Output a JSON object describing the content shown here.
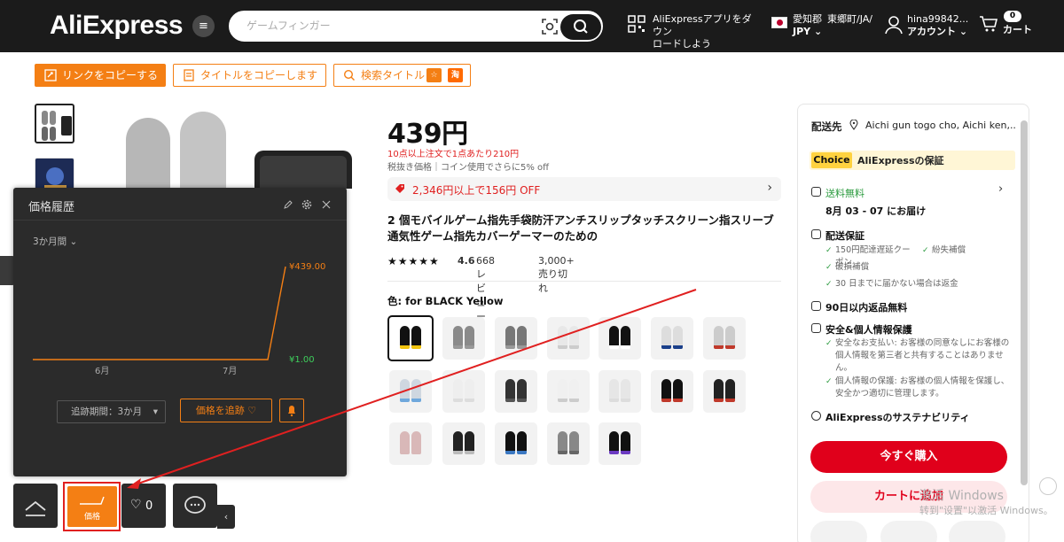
{
  "header": {
    "logo": "AliExpress",
    "search_placeholder": "ゲームフィンガー",
    "app_line1": "AliExpressアプリをダウン",
    "app_line2": "ロードしよう",
    "region": "愛知郡",
    "currency": "JPY",
    "address": "東郷町/JA/",
    "user": "hina99842...",
    "account": "アカウント",
    "cart_count": "0",
    "cart_label": "カート"
  },
  "toolbar": {
    "copy_link": "リンクをコピーする",
    "copy_title": "タイトルをコピーします",
    "search_title": "検索タイトル"
  },
  "product": {
    "price": "439円",
    "bulk_offer": "10点以上注文で1点あたり210円",
    "tax_note": "税抜き価格｜コイン使用でさらに5% off",
    "coupon": "2,346円以上で156円 OFF",
    "title": "2 個モバイルゲーム指先手袋防汗アンチスリップタッチスクリーン指スリーブ通気性ゲーム指先カバーゲーマーのための",
    "stars": "★★★★★",
    "rating": "4.6",
    "reviews": "668 レビュー",
    "sold": "3,000+ 売り切れ",
    "color_label": "色: for BLACK Yellow"
  },
  "right_panel": {
    "ship_label": "配送先",
    "ship_address": "Aichi gun togo cho, Aichi ken,...",
    "choice_badge": "Choice",
    "choice_text": "AliExpressの保証",
    "free_shipping": "送料無料",
    "delivery": "8月 03 - 07 にお届け",
    "guarantee_title": "配送保証",
    "guarantee_items": [
      "150円配達遅延クーポン",
      "紛失補償",
      "破損補償",
      "30 日までに届かない場合は返金"
    ],
    "returns": "90日以内返品無料",
    "safety_title": "安全&個人情報保護",
    "safety_items": [
      "安全なお支払い: お客様の同意なしにお客様の個人情報を第三者と共有することはありません。",
      "個人情報の保護: お客様の個人情報を保護し、安全かつ適切に管理します。"
    ],
    "sustainability": "AliExpressのサステナビリティ",
    "buy_now": "今すぐ購入",
    "add_to_cart": "カートに追加"
  },
  "watermark": {
    "line1": "激活 Windows",
    "line2": "转到\"设置\"以激活 Windows。"
  },
  "price_history": {
    "title": "価格履歴",
    "range": "3か月間",
    "track_period": "追跡期間：3か月",
    "track_button": "価格を追跡 ♡"
  },
  "dock": {
    "price_label": "価格",
    "fav_count": "0"
  },
  "chart_data": {
    "type": "line",
    "x": [
      "6月",
      "7月",
      "end"
    ],
    "tick_labels": [
      "6月",
      "7月"
    ],
    "series": [
      {
        "values": [
          1.0,
          1.0,
          439.0
        ]
      }
    ],
    "y_labels": [
      "¥439.00",
      "¥1.00"
    ],
    "ylim": [
      1.0,
      439.0
    ],
    "color": "#f47f14",
    "grid": false
  }
}
